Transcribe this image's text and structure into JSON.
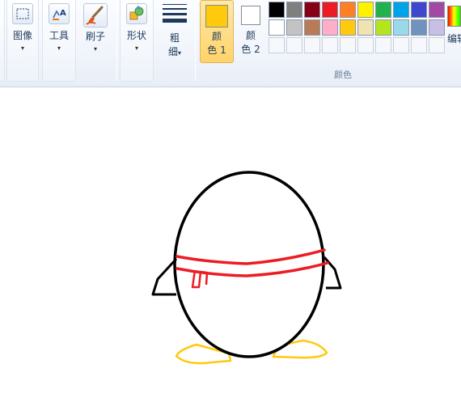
{
  "ribbon": {
    "image_label": "图像",
    "tools_label": "工具",
    "brushes_label": "刷子",
    "shapes_label": "形状",
    "size_label_line1": "粗",
    "size_label_line2": "细",
    "color1_line1": "颜",
    "color1_line2": "色 1",
    "color2_line1": "颜",
    "color2_line2": "色 2",
    "colors_group_label": "颜色",
    "edit_colors_label": "编辑",
    "dropdown_glyph": "▾"
  },
  "colors": {
    "color1": "#ffc90e",
    "color2": "#ffffff",
    "palette_row1": [
      "#000000",
      "#7f7f7f",
      "#880015",
      "#ed1c24",
      "#ff7f27",
      "#fff200",
      "#22b14c",
      "#00a2e8",
      "#3f48cc",
      "#a349a4"
    ],
    "palette_row2": [
      "#ffffff",
      "#c3c3c3",
      "#b97a57",
      "#ffaec9",
      "#ffc90e",
      "#efe4b0",
      "#b5e61d",
      "#99d9ea",
      "#7092be",
      "#c8bfe7"
    ],
    "palette_row3_empty_count": 10
  },
  "drawing": {
    "outline_color": "#000000",
    "scarf_color": "#ed1c24",
    "feet_color": "#ffc90e"
  }
}
